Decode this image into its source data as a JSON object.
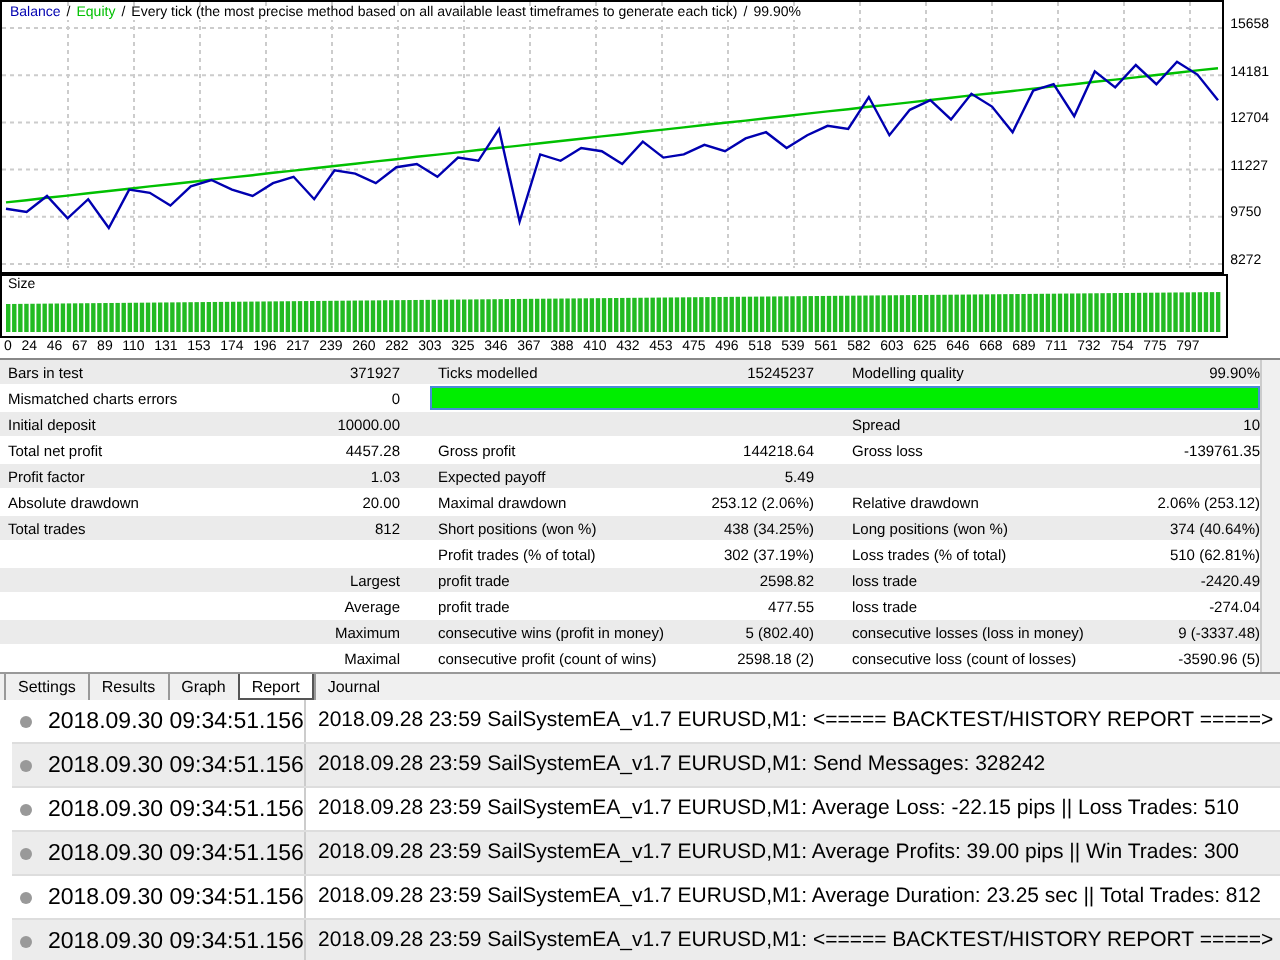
{
  "balance_chart": {
    "legend": [
      "Every tick (the most precise method based on all available least timeframes to generate each tick)",
      "99.90%"
    ],
    "separator": "/",
    "chart_data": {
      "type": "line",
      "ylim": [
        8272,
        15658
      ],
      "yticks": [
        {
          "value": 8272,
          "label": "8272"
        },
        {
          "value": 9750,
          "label": "9750"
        },
        {
          "value": 11227,
          "label": "11227"
        },
        {
          "value": 12704,
          "label": "12704"
        },
        {
          "value": 14181,
          "label": "14181"
        },
        {
          "value": 15658,
          "label": "15658"
        }
      ],
      "series": [
        {
          "name": "Balance",
          "color": "#0000b0",
          "values": [
            10000,
            9900,
            10400,
            9700,
            10300,
            9400,
            10600,
            10500,
            10100,
            10700,
            10900,
            10600,
            10400,
            10800,
            11000,
            10300,
            11200,
            11100,
            10800,
            11300,
            11400,
            11000,
            11600,
            11500,
            12500,
            9600,
            11700,
            11500,
            11900,
            11800,
            11400,
            12100,
            11600,
            11700,
            12000,
            11800,
            12200,
            12400,
            11900,
            12300,
            12600,
            12500,
            13500,
            12300,
            13100,
            13400,
            12800,
            13600,
            13200,
            12400,
            13700,
            13900,
            12900,
            14300,
            13800,
            14500,
            13900,
            14600,
            14200,
            13400
          ]
        },
        {
          "name": "Equity",
          "color": "#00c000",
          "values": [
            10200,
            10271,
            10342,
            10414,
            10485,
            10556,
            10627,
            10698,
            10769,
            10841,
            10912,
            10983,
            11054,
            11125,
            11197,
            11268,
            11339,
            11410,
            11481,
            11553,
            11624,
            11695,
            11766,
            11837,
            11908,
            11980,
            12051,
            12122,
            12193,
            12264,
            12336,
            12407,
            12478,
            12549,
            12620,
            12692,
            12763,
            12834,
            12905,
            12976,
            13047,
            13119,
            13190,
            13261,
            13332,
            13403,
            13475,
            13546,
            13617,
            13688,
            13759,
            13831,
            13902,
            13973,
            14044,
            14115,
            14186,
            14258,
            14329,
            14400
          ]
        }
      ],
      "grid": true
    }
  },
  "size_chart": {
    "label": "Size",
    "x_labels": [
      "0",
      "24",
      "46",
      "67",
      "89",
      "110",
      "131",
      "153",
      "174",
      "196",
      "217",
      "239",
      "260",
      "282",
      "303",
      "325",
      "346",
      "367",
      "388",
      "410",
      "432",
      "453",
      "475",
      "496",
      "518",
      "539",
      "561",
      "582",
      "603",
      "625",
      "646",
      "668",
      "689",
      "711",
      "732",
      "754",
      "775",
      "797"
    ]
  },
  "report": {
    "rows": [
      {
        "label_1": "Bars in test",
        "value_1": "371927",
        "label_2": "Ticks modelled",
        "value_2": "15245237",
        "label_3": "Modelling quality",
        "value_3": "99.90%"
      },
      {
        "label_1": "Mismatched charts errors",
        "value_1": "0",
        "level": 0.999
      },
      {
        "label_1": "Initial deposit",
        "value_1": "10000.00",
        "label_3": "Spread",
        "value_3": "10"
      },
      {
        "label_1": "Total net profit",
        "value_1": "4457.28",
        "label_2": "Gross profit",
        "value_2": "144218.64",
        "label_3": "Gross loss",
        "value_3": "-139761.35"
      },
      {
        "label_1": "Profit factor",
        "value_1": "1.03",
        "label_2": "Expected payoff",
        "value_2": "5.49"
      },
      {
        "label_1": "Absolute drawdown",
        "value_1": "20.00",
        "label_2": "Maximal drawdown",
        "value_2": "253.12 (2.06%)",
        "label_3": "Relative drawdown",
        "value_3": "2.06% (253.12)"
      },
      {
        "label_1": "Total trades",
        "value_1": "812",
        "label_2": "Short positions (won %)",
        "value_2": "438 (34.25%)",
        "label_3": "Long positions (won %)",
        "value_3": "374 (40.64%)"
      },
      {
        "label_2": "Profit trades (% of total)",
        "value_2": "302 (37.19%)",
        "label_3": "Loss trades (% of total)",
        "value_3": "510 (62.81%)"
      },
      {
        "value_1": "Largest",
        "label_2": "profit trade",
        "value_2": "2598.82",
        "label_3": "loss trade",
        "value_3": "-2420.49"
      },
      {
        "value_1": "Average",
        "label_2": "profit trade",
        "value_2": "477.55",
        "label_3": "loss trade",
        "value_3": "-274.04"
      },
      {
        "value_1": "Maximum",
        "label_2": "consecutive wins (profit in money)",
        "value_2": "5 (802.40)",
        "label_3": "consecutive losses (loss in money)",
        "value_3": "9 (-3337.48)"
      },
      {
        "value_1": "Maximal",
        "label_2": "consecutive profit (count of wins)",
        "value_2": "2598.18 (2)",
        "label_3": "consecutive loss (count of losses)",
        "value_3": "-3590.96 (5)"
      }
    ]
  },
  "tabs": [
    {
      "label": "Settings",
      "selected": false
    },
    {
      "label": "Results",
      "selected": false
    },
    {
      "label": "Graph",
      "selected": false
    },
    {
      "label": "Report",
      "selected": true
    },
    {
      "label": "Journal",
      "selected": false
    }
  ],
  "journal": [
    {
      "time": "2018.09.30 09:34:51.156",
      "message": "2018.09.28 23:59  SailSystemEA_v1.7 EURUSD,M1: <===== BACKTEST/HISTORY REPORT =====>"
    },
    {
      "time": "2018.09.30 09:34:51.156",
      "message": "2018.09.28 23:59  SailSystemEA_v1.7 EURUSD,M1: Send Messages: 328242"
    },
    {
      "time": "2018.09.30 09:34:51.156",
      "message": "2018.09.28 23:59  SailSystemEA_v1.7 EURUSD,M1: Average Loss: -22.15 pips || Loss Trades: 510"
    },
    {
      "time": "2018.09.30 09:34:51.156",
      "message": "2018.09.28 23:59  SailSystemEA_v1.7 EURUSD,M1: Average Profits: 39.00 pips || Win Trades: 300"
    },
    {
      "time": "2018.09.30 09:34:51.156",
      "message": "2018.09.28 23:59  SailSystemEA_v1.7 EURUSD,M1: Average Duration: 23.25 sec || Total Trades: 812"
    },
    {
      "time": "2018.09.30 09:34:51.156",
      "message": "2018.09.28 23:59  SailSystemEA_v1.7 EURUSD,M1: <===== BACKTEST/HISTORY REPORT =====>"
    }
  ]
}
